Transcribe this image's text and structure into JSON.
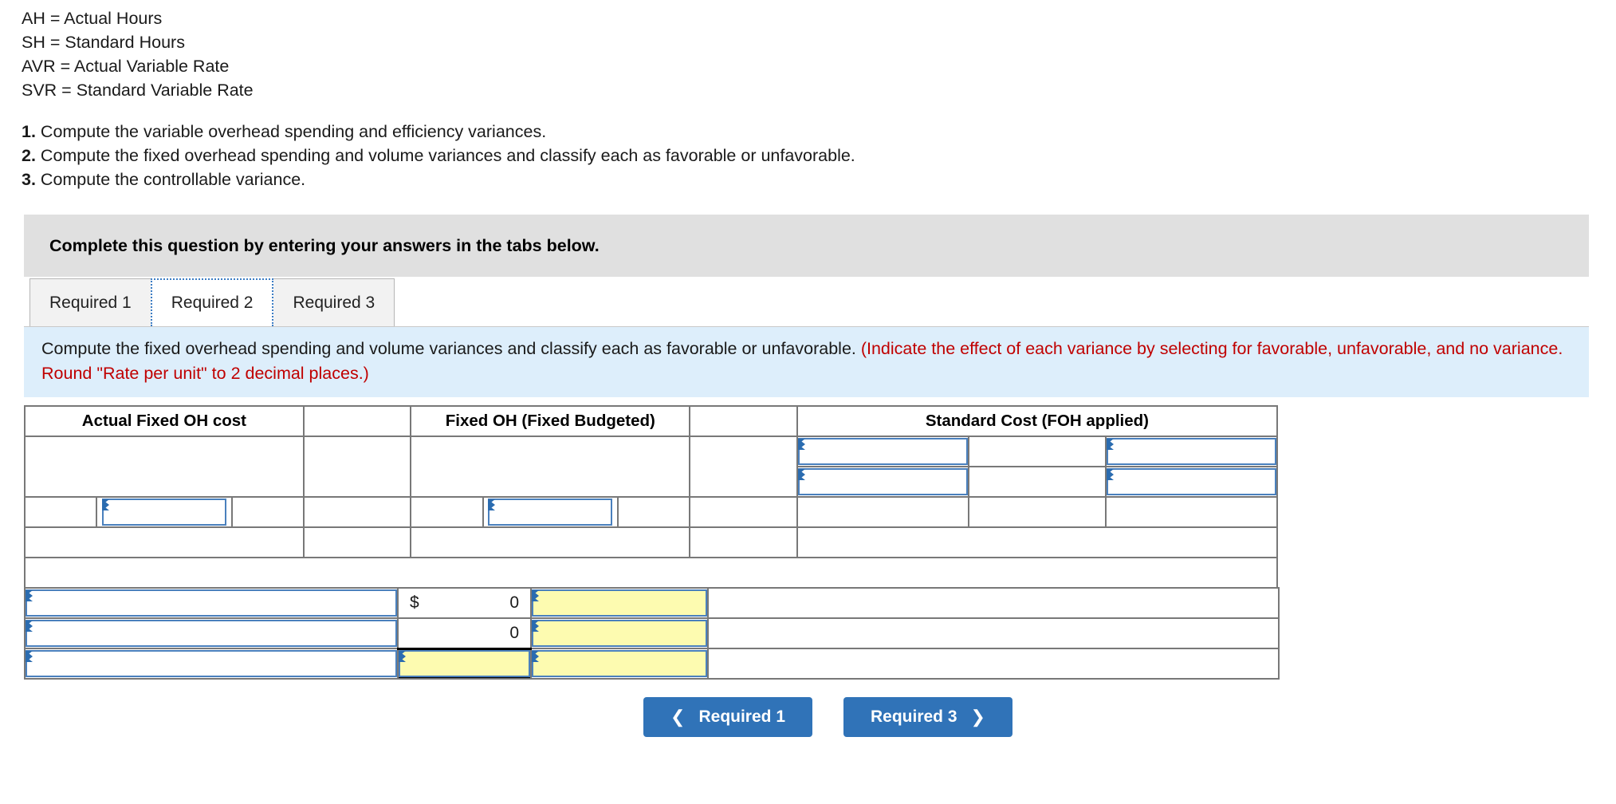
{
  "legend": [
    "AH = Actual Hours",
    "SH = Standard Hours",
    "AVR = Actual Variable Rate",
    "SVR = Standard Variable Rate"
  ],
  "requirements": [
    {
      "num": "1.",
      "text": " Compute the variable overhead spending and efficiency variances."
    },
    {
      "num": "2.",
      "text": " Compute the fixed overhead spending and volume variances and classify each as favorable or unfavorable."
    },
    {
      "num": "3.",
      "text": " Compute the controllable variance."
    }
  ],
  "banner": {
    "text": "Complete this question by entering your answers in the tabs below."
  },
  "tabs": [
    {
      "label": "Required 1",
      "active": false
    },
    {
      "label": "Required 2",
      "active": true
    },
    {
      "label": "Required 3",
      "active": false
    }
  ],
  "instruction": {
    "black": "Compute the fixed overhead spending and volume variances and classify each as favorable or unfavorable. ",
    "red": "(Indicate the effect of each variance by selecting for favorable, unfavorable, and no variance. Round \"Rate per unit\" to 2 decimal places.)"
  },
  "table": {
    "headers": [
      "Actual Fixed OH cost",
      "Fixed OH (Fixed Budgeted)",
      "Standard Cost (FOH applied)"
    ],
    "bottom_rows": [
      {
        "label": "",
        "currency": "$",
        "amount": "0",
        "effect": ""
      },
      {
        "label": "",
        "currency": "",
        "amount": "0",
        "effect": ""
      },
      {
        "label": "",
        "currency": "",
        "amount": "",
        "effect": ""
      }
    ]
  },
  "nav": {
    "prev_label": "Required 1",
    "next_label": "Required 3",
    "prev_icon": "chevron-left",
    "next_icon": "chevron-right"
  },
  "colors": {
    "header_blue": "#7eb0e2",
    "banner_gray": "#e0e0e0",
    "info_blue": "#ddeefb",
    "red_text": "#c00000",
    "input_yellow": "#fdfbb0",
    "button_blue": "#3073b8"
  }
}
